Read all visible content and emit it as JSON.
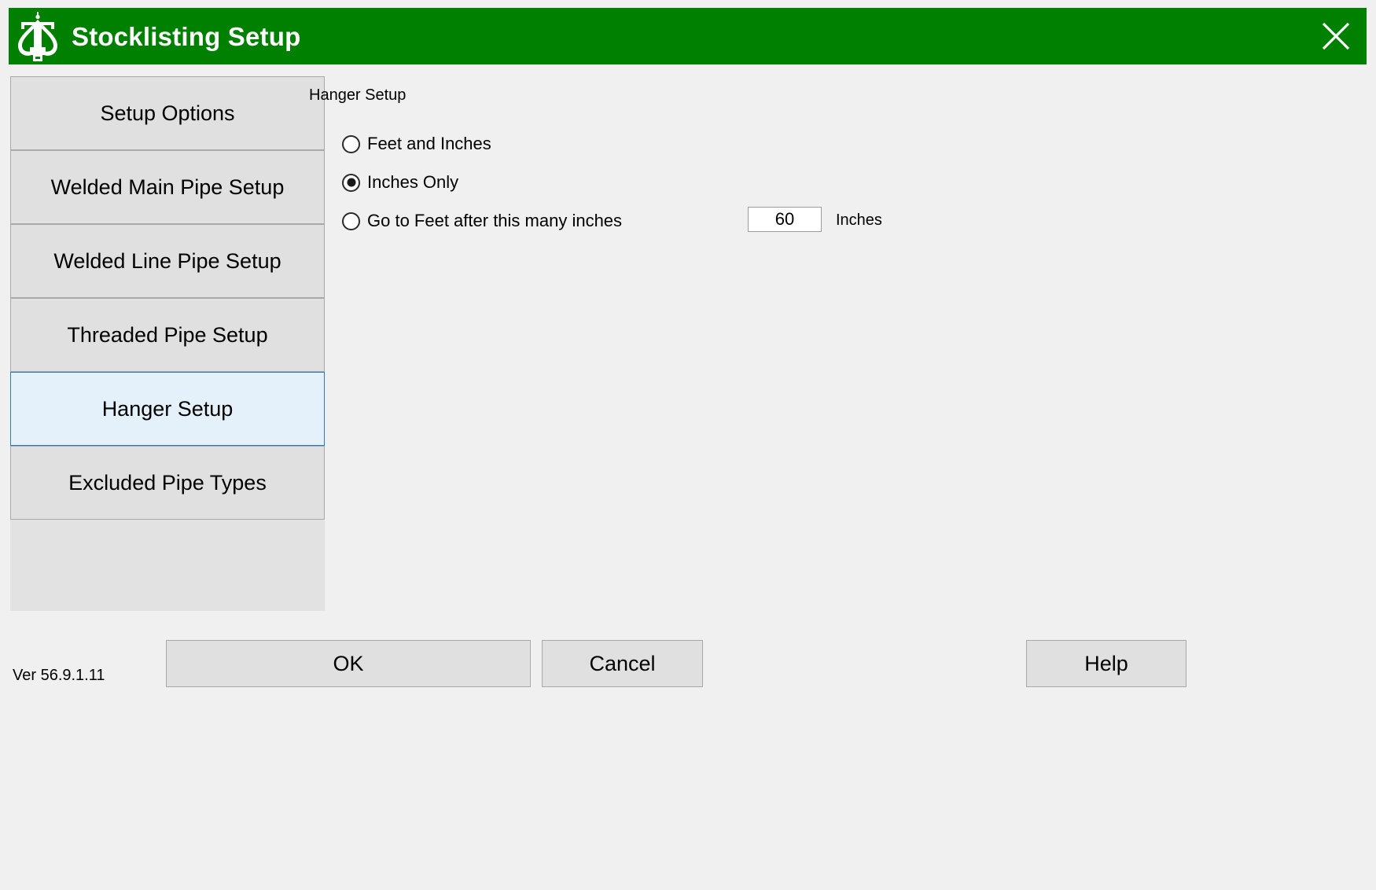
{
  "window": {
    "title": "Stocklisting Setup",
    "logo_icon": "sprinkler-head-logo-icon",
    "close_icon": "close-icon",
    "titlebar_color": "#008000",
    "title_color": "#ffffff",
    "background_color": "#f0f0f0"
  },
  "sidebar": {
    "items": [
      {
        "label": "Setup Options",
        "selected": false
      },
      {
        "label": "Welded Main Pipe Setup",
        "selected": false
      },
      {
        "label": "Welded Line Pipe Setup",
        "selected": false
      },
      {
        "label": "Threaded Pipe Setup",
        "selected": false
      },
      {
        "label": "Hanger Setup",
        "selected": true
      },
      {
        "label": "Excluded Pipe Types",
        "selected": false
      }
    ],
    "selected_background": "#e4f1fb",
    "selected_border": "#2b7bba",
    "button_background": "#e0e0e0",
    "button_border": "#a9a9a9"
  },
  "main": {
    "section_label": "Hanger Setup",
    "radio_group": {
      "name": "hanger-units",
      "options": [
        {
          "label": "Feet and Inches",
          "checked": false
        },
        {
          "label": "Inches Only",
          "checked": true
        },
        {
          "label": "Go to Feet after this many inches",
          "checked": false
        }
      ]
    },
    "inches_field": {
      "value": "60",
      "placeholder": "",
      "unit_label": "Inches"
    }
  },
  "footer": {
    "version": "Ver 56.9.1.11",
    "ok_label": "OK",
    "cancel_label": "Cancel",
    "help_label": "Help"
  }
}
